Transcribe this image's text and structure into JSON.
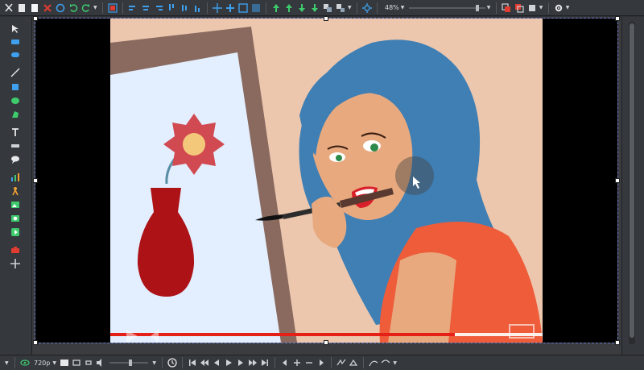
{
  "toolbar": {
    "zoom_value": "48%",
    "icons": [
      "cut-icon",
      "copy-icon",
      "paste-icon",
      "delete-icon",
      "circle-icon",
      "undo-icon",
      "redo-icon",
      "select-all-icon",
      "align-left-icon",
      "align-center-icon",
      "align-right-icon",
      "align-top-icon",
      "align-middle-icon",
      "align-bottom-icon",
      "move-icon",
      "resize-icon",
      "fit-icon",
      "distribute-icon",
      "bring-forward-icon",
      "send-backward-icon",
      "bring-front-icon",
      "send-back-icon",
      "group-icon",
      "ungroup-icon",
      "pan-icon",
      "zoom-in-icon",
      "zoom-out-icon",
      "settings-icon"
    ]
  },
  "left_tools": [
    "pointer-tool",
    "rectangle-tool",
    "rounded-rect-tool",
    "line-tool",
    "square-tool",
    "ellipse-tool",
    "polygon-tool",
    "text-tool",
    "counter-tool",
    "speech-bubble-tool",
    "chart-tool",
    "character-tool",
    "image-tool",
    "video-tool",
    "audio-tool",
    "camera-tool",
    "layers-tool",
    "move-tool"
  ],
  "bottom": {
    "resolution": "720p",
    "controls": [
      "first-frame-icon",
      "prev-frame-icon",
      "play-icon",
      "next-frame-icon",
      "last-frame-icon"
    ]
  },
  "colors": {
    "wall": "#ecc7ae",
    "canvas_bg": "#e3efff",
    "frame": "#8a6a5f",
    "hair": "#3f7fb4",
    "skin": "#e8a97f",
    "dress": "#ee5c3a",
    "vase": "#ac1216",
    "flower": "#d14a52",
    "progress": "#e52117"
  }
}
